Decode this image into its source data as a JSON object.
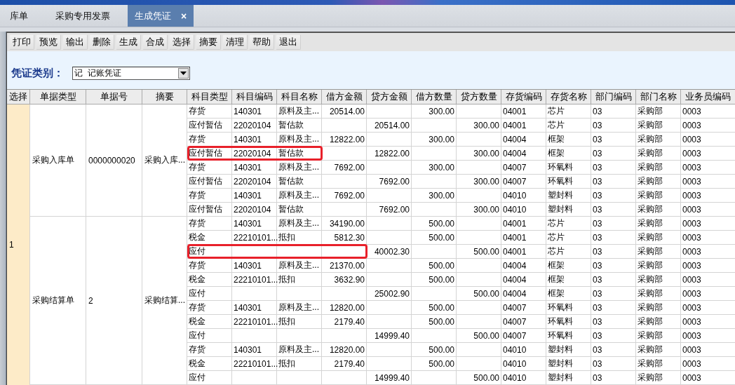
{
  "tabs": [
    {
      "label": "库单",
      "selected": false
    },
    {
      "label": "采购专用发票",
      "selected": false
    },
    {
      "label": "生成凭证",
      "selected": true,
      "close": "×"
    }
  ],
  "toolbar": [
    "打印",
    "预览",
    "输出",
    "删除",
    "生成",
    "合成",
    "选择",
    "摘要",
    "清理",
    "帮助",
    "退出"
  ],
  "voucher_type": {
    "label": "凭证类别：",
    "value": "记  记账凭证"
  },
  "table": {
    "columns": [
      "选择",
      "单据类型",
      "单据号",
      "摘要",
      "科目类型",
      "科目编码",
      "科目名称",
      "借方金额",
      "贷方金额",
      "借方数量",
      "贷方数量",
      "存货编码",
      "存货名称",
      "部门编码",
      "部门名称",
      "业务员编码"
    ],
    "select_value": "1",
    "groups": [
      {
        "doc_type": "采购入库单",
        "doc_no": "0000000020",
        "summary": "采购入库...",
        "rows": [
          {
            "cells": [
              "存货",
              "140301",
              "原料及主...",
              "20514.00",
              null,
              "300.00",
              null,
              "04001",
              "芯片",
              "03",
              "采购部",
              "0003"
            ]
          },
          {
            "cells": [
              "应付暂估",
              "22020104",
              "暂估款",
              null,
              "20514.00",
              null,
              "300.00",
              "04001",
              "芯片",
              "03",
              "采购部",
              "0003"
            ]
          },
          {
            "cells": [
              "存货",
              "140301",
              "原料及主...",
              "12822.00",
              null,
              "300.00",
              null,
              "04004",
              "框架",
              "03",
              "采购部",
              "0003"
            ]
          },
          {
            "cells": [
              "应付暂估",
              "22020104",
              "暂估款",
              null,
              "12822.00",
              null,
              "300.00",
              "04004",
              "框架",
              "03",
              "采购部",
              "0003"
            ],
            "highlighted": true
          },
          {
            "cells": [
              "存货",
              "140301",
              "原料及主...",
              "7692.00",
              null,
              "300.00",
              null,
              "04007",
              "环氧料",
              "03",
              "采购部",
              "0003"
            ]
          },
          {
            "cells": [
              "应付暂估",
              "22020104",
              "暂估款",
              null,
              "7692.00",
              null,
              "300.00",
              "04007",
              "环氧料",
              "03",
              "采购部",
              "0003"
            ]
          },
          {
            "cells": [
              "存货",
              "140301",
              "原料及主...",
              "7692.00",
              null,
              "300.00",
              null,
              "04010",
              "塑封料",
              "03",
              "采购部",
              "0003"
            ]
          },
          {
            "cells": [
              "应付暂估",
              "22020104",
              "暂估款",
              null,
              "7692.00",
              null,
              "300.00",
              "04010",
              "塑封料",
              "03",
              "采购部",
              "0003"
            ]
          }
        ]
      },
      {
        "doc_type": "采购结算单",
        "doc_no": "2",
        "summary": "采购结算...",
        "rows": [
          {
            "cells": [
              "存货",
              "140301",
              "原料及主...",
              "34190.00",
              null,
              "500.00",
              null,
              "04001",
              "芯片",
              "03",
              "采购部",
              "0003"
            ]
          },
          {
            "cells": [
              "税金",
              "22210101...",
              "抵扣",
              "5812.30",
              null,
              "500.00",
              null,
              "04001",
              "芯片",
              "03",
              "采购部",
              "0003"
            ]
          },
          {
            "cells": [
              "应付",
              null,
              null,
              null,
              "40002.30",
              null,
              "500.00",
              "04001",
              "芯片",
              "03",
              "采购部",
              "0003"
            ],
            "highlighted": true,
            "highlight_extended": true
          },
          {
            "cells": [
              "存货",
              "140301",
              "原料及主...",
              "21370.00",
              null,
              "500.00",
              null,
              "04004",
              "框架",
              "03",
              "采购部",
              "0003"
            ]
          },
          {
            "cells": [
              "税金",
              "22210101...",
              "抵扣",
              "3632.90",
              null,
              "500.00",
              null,
              "04004",
              "框架",
              "03",
              "采购部",
              "0003"
            ]
          },
          {
            "cells": [
              "应付",
              null,
              null,
              null,
              "25002.90",
              null,
              "500.00",
              "04004",
              "框架",
              "03",
              "采购部",
              "0003"
            ]
          },
          {
            "cells": [
              "存货",
              "140301",
              "原料及主...",
              "12820.00",
              null,
              "500.00",
              null,
              "04007",
              "环氧料",
              "03",
              "采购部",
              "0003"
            ]
          },
          {
            "cells": [
              "税金",
              "22210101...",
              "抵扣",
              "2179.40",
              null,
              "500.00",
              null,
              "04007",
              "环氧料",
              "03",
              "采购部",
              "0003"
            ]
          },
          {
            "cells": [
              "应付",
              null,
              null,
              null,
              "14999.40",
              null,
              "500.00",
              "04007",
              "环氧料",
              "03",
              "采购部",
              "0003"
            ]
          },
          {
            "cells": [
              "存货",
              "140301",
              "原料及主...",
              "12820.00",
              null,
              "500.00",
              null,
              "04010",
              "塑封料",
              "03",
              "采购部",
              "0003"
            ]
          },
          {
            "cells": [
              "税金",
              "22210101...",
              "抵扣",
              "2179.40",
              null,
              "500.00",
              null,
              "04010",
              "塑封料",
              "03",
              "采购部",
              "0003"
            ]
          },
          {
            "cells": [
              "应付",
              null,
              null,
              null,
              "14999.40",
              null,
              "500.00",
              "04010",
              "塑封料",
              "03",
              "采购部",
              "0003"
            ]
          }
        ]
      }
    ]
  }
}
